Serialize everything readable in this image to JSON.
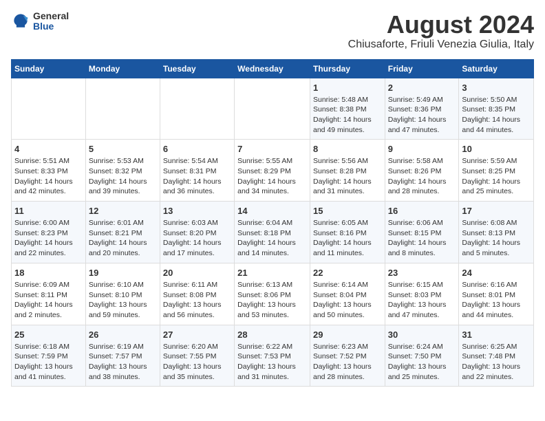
{
  "logo": {
    "general": "General",
    "blue": "Blue"
  },
  "title": {
    "month_year": "August 2024",
    "location": "Chiusaforte, Friuli Venezia Giulia, Italy"
  },
  "headers": [
    "Sunday",
    "Monday",
    "Tuesday",
    "Wednesday",
    "Thursday",
    "Friday",
    "Saturday"
  ],
  "weeks": [
    [
      {
        "day": "",
        "info": ""
      },
      {
        "day": "",
        "info": ""
      },
      {
        "day": "",
        "info": ""
      },
      {
        "day": "",
        "info": ""
      },
      {
        "day": "1",
        "info": "Sunrise: 5:48 AM\nSunset: 8:38 PM\nDaylight: 14 hours and 49 minutes."
      },
      {
        "day": "2",
        "info": "Sunrise: 5:49 AM\nSunset: 8:36 PM\nDaylight: 14 hours and 47 minutes."
      },
      {
        "day": "3",
        "info": "Sunrise: 5:50 AM\nSunset: 8:35 PM\nDaylight: 14 hours and 44 minutes."
      }
    ],
    [
      {
        "day": "4",
        "info": "Sunrise: 5:51 AM\nSunset: 8:33 PM\nDaylight: 14 hours and 42 minutes."
      },
      {
        "day": "5",
        "info": "Sunrise: 5:53 AM\nSunset: 8:32 PM\nDaylight: 14 hours and 39 minutes."
      },
      {
        "day": "6",
        "info": "Sunrise: 5:54 AM\nSunset: 8:31 PM\nDaylight: 14 hours and 36 minutes."
      },
      {
        "day": "7",
        "info": "Sunrise: 5:55 AM\nSunset: 8:29 PM\nDaylight: 14 hours and 34 minutes."
      },
      {
        "day": "8",
        "info": "Sunrise: 5:56 AM\nSunset: 8:28 PM\nDaylight: 14 hours and 31 minutes."
      },
      {
        "day": "9",
        "info": "Sunrise: 5:58 AM\nSunset: 8:26 PM\nDaylight: 14 hours and 28 minutes."
      },
      {
        "day": "10",
        "info": "Sunrise: 5:59 AM\nSunset: 8:25 PM\nDaylight: 14 hours and 25 minutes."
      }
    ],
    [
      {
        "day": "11",
        "info": "Sunrise: 6:00 AM\nSunset: 8:23 PM\nDaylight: 14 hours and 22 minutes."
      },
      {
        "day": "12",
        "info": "Sunrise: 6:01 AM\nSunset: 8:21 PM\nDaylight: 14 hours and 20 minutes."
      },
      {
        "day": "13",
        "info": "Sunrise: 6:03 AM\nSunset: 8:20 PM\nDaylight: 14 hours and 17 minutes."
      },
      {
        "day": "14",
        "info": "Sunrise: 6:04 AM\nSunset: 8:18 PM\nDaylight: 14 hours and 14 minutes."
      },
      {
        "day": "15",
        "info": "Sunrise: 6:05 AM\nSunset: 8:16 PM\nDaylight: 14 hours and 11 minutes."
      },
      {
        "day": "16",
        "info": "Sunrise: 6:06 AM\nSunset: 8:15 PM\nDaylight: 14 hours and 8 minutes."
      },
      {
        "day": "17",
        "info": "Sunrise: 6:08 AM\nSunset: 8:13 PM\nDaylight: 14 hours and 5 minutes."
      }
    ],
    [
      {
        "day": "18",
        "info": "Sunrise: 6:09 AM\nSunset: 8:11 PM\nDaylight: 14 hours and 2 minutes."
      },
      {
        "day": "19",
        "info": "Sunrise: 6:10 AM\nSunset: 8:10 PM\nDaylight: 13 hours and 59 minutes."
      },
      {
        "day": "20",
        "info": "Sunrise: 6:11 AM\nSunset: 8:08 PM\nDaylight: 13 hours and 56 minutes."
      },
      {
        "day": "21",
        "info": "Sunrise: 6:13 AM\nSunset: 8:06 PM\nDaylight: 13 hours and 53 minutes."
      },
      {
        "day": "22",
        "info": "Sunrise: 6:14 AM\nSunset: 8:04 PM\nDaylight: 13 hours and 50 minutes."
      },
      {
        "day": "23",
        "info": "Sunrise: 6:15 AM\nSunset: 8:03 PM\nDaylight: 13 hours and 47 minutes."
      },
      {
        "day": "24",
        "info": "Sunrise: 6:16 AM\nSunset: 8:01 PM\nDaylight: 13 hours and 44 minutes."
      }
    ],
    [
      {
        "day": "25",
        "info": "Sunrise: 6:18 AM\nSunset: 7:59 PM\nDaylight: 13 hours and 41 minutes."
      },
      {
        "day": "26",
        "info": "Sunrise: 6:19 AM\nSunset: 7:57 PM\nDaylight: 13 hours and 38 minutes."
      },
      {
        "day": "27",
        "info": "Sunrise: 6:20 AM\nSunset: 7:55 PM\nDaylight: 13 hours and 35 minutes."
      },
      {
        "day": "28",
        "info": "Sunrise: 6:22 AM\nSunset: 7:53 PM\nDaylight: 13 hours and 31 minutes."
      },
      {
        "day": "29",
        "info": "Sunrise: 6:23 AM\nSunset: 7:52 PM\nDaylight: 13 hours and 28 minutes."
      },
      {
        "day": "30",
        "info": "Sunrise: 6:24 AM\nSunset: 7:50 PM\nDaylight: 13 hours and 25 minutes."
      },
      {
        "day": "31",
        "info": "Sunrise: 6:25 AM\nSunset: 7:48 PM\nDaylight: 13 hours and 22 minutes."
      }
    ]
  ]
}
